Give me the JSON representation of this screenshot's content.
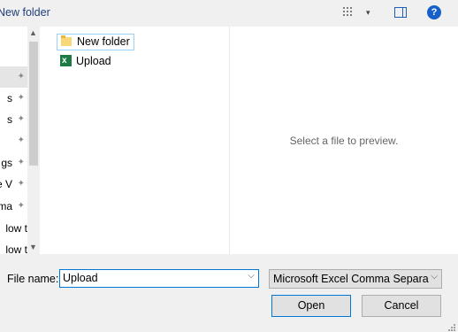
{
  "toolbar": {
    "new_folder_label": "New folder",
    "view_icon": "grid-view-icon",
    "view_caret": "▾",
    "pane_icon": "preview-pane-icon",
    "help_icon": "help-icon",
    "help_label": "?"
  },
  "nav_pane": {
    "items": [
      {
        "text": "",
        "pinned": true,
        "selected": true
      },
      {
        "text": "s",
        "pinned": true,
        "selected": false
      },
      {
        "text": "s",
        "pinned": true,
        "selected": false
      },
      {
        "text": "",
        "pinned": true,
        "selected": false
      },
      {
        "text": "gs",
        "pinned": true,
        "selected": false
      },
      {
        "text": "e V",
        "pinned": true,
        "selected": false
      },
      {
        "text": "ma",
        "pinned": true,
        "selected": false
      },
      {
        "text": "low t",
        "pinned": false,
        "selected": false
      },
      {
        "text": "low t",
        "pinned": false,
        "selected": false
      }
    ],
    "pin_glyph": "✦",
    "scroll_up": "▲",
    "scroll_down": "▼"
  },
  "files": [
    {
      "name": "New folder",
      "icon": "folder-icon",
      "focused": true
    },
    {
      "name": "Upload",
      "icon": "excel-file-icon",
      "focused": false
    }
  ],
  "preview": {
    "message": "Select a file to preview."
  },
  "bottom": {
    "file_name_label": "File name:",
    "file_name_value": "Upload",
    "combo_caret": "⌵",
    "file_type_value": "Microsoft Excel Comma Separa",
    "open_label": "Open",
    "cancel_label": "Cancel"
  },
  "colors": {
    "accent": "#0078d7",
    "help_blue": "#1560c9",
    "folder_yellow": "#f8d775",
    "excel_green": "#1d7a44"
  }
}
